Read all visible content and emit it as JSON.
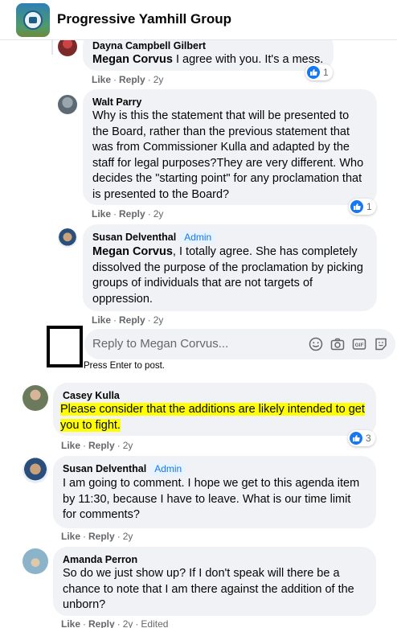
{
  "header": {
    "group_name": "Progressive Yamhill Group"
  },
  "actions": {
    "like": "Like",
    "reply": "Reply",
    "dot": "·"
  },
  "comments": [
    {
      "author": "Dayna Campbell Gilbert",
      "mention": "Megan Corvus",
      "text": " I agree with you. It's a mess.",
      "time": "2y",
      "likes": "1"
    },
    {
      "author": "Walt Parry",
      "text": "Why is this the statement that will be presented to the Board, rather than the previous statement that was from Commissioner Kulla and adapted by the staff for legal purposes?They are very different. Who decides the \"starting point\" for any proclamation that is presented to the Board?",
      "time": "2y",
      "likes": "1"
    },
    {
      "author": "Susan Delventhal",
      "badge": "Admin",
      "mention": "Megan Corvus",
      "text": ", I totally agree. She has completely dissolved the purpose of the proclamation by picking groups of individuals that are not targets of oppression.",
      "time": "2y"
    },
    {
      "author": "Casey Kulla",
      "text": "Please consider that the additions are likely intended to get you to fight.",
      "time": "2y",
      "likes": "3"
    },
    {
      "author": "Susan Delventhal",
      "badge": "Admin",
      "text": "I am going to comment. I hope we get to this agenda item by 11:30, because I have to leave. What is our time limit for comments?",
      "time": "2y"
    },
    {
      "author": "Amanda Perron",
      "text": "So do we just show up? If I don't speak will there be a chance to note that I am there against the addition of the unborn?",
      "time": "2y",
      "edited": "Edited"
    }
  ],
  "reply_box": {
    "placeholder": "Reply to Megan Corvus...",
    "hint": "Press Enter to post.",
    "icons": [
      "smiley-icon",
      "camera-icon",
      "gif-icon",
      "sticker-icon"
    ]
  },
  "colors": {
    "accent": "#1877f2",
    "highlight": "#ffff00",
    "bubble": "#f0f2f5",
    "meta": "#65676b"
  }
}
